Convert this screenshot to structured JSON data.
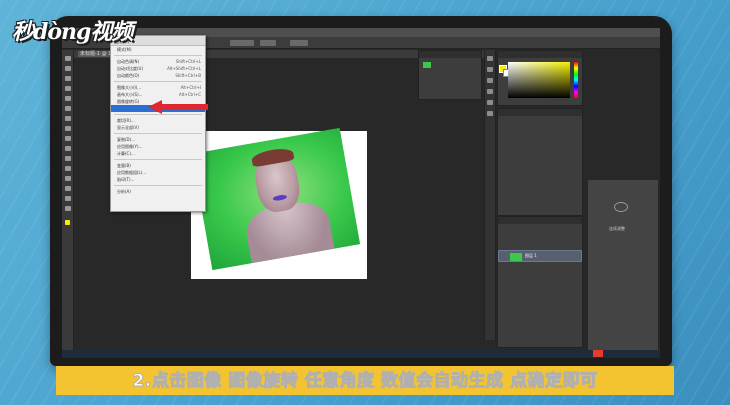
{
  "logo": {
    "text": "秒dòng视频"
  },
  "photoshop": {
    "doc_tab": "未标题-1 @ 100%",
    "menu": {
      "title": "图像(I)",
      "items": [
        {
          "label": "模式(M)",
          "shortcut": ""
        },
        {
          "label": "自动色调(N)",
          "shortcut": "Shift+Ctrl+L"
        },
        {
          "label": "自动对比度(U)",
          "shortcut": "Alt+Shift+Ctrl+L"
        },
        {
          "label": "自动颜色(O)",
          "shortcut": "Shift+Ctrl+B"
        },
        {
          "label": "图像大小(I)...",
          "shortcut": "Alt+Ctrl+I"
        },
        {
          "label": "画布大小(S)...",
          "shortcut": "Alt+Ctrl+C"
        },
        {
          "label": "图像旋转(G)",
          "shortcut": ""
        },
        {
          "label": "",
          "shortcut": ""
        },
        {
          "label": "裁切(R)...",
          "shortcut": ""
        },
        {
          "label": "显示全部(V)",
          "shortcut": ""
        },
        {
          "label": "复制(D)...",
          "shortcut": ""
        },
        {
          "label": "应用图像(Y)...",
          "shortcut": ""
        },
        {
          "label": "计算(C)...",
          "shortcut": ""
        },
        {
          "label": "变量(B)",
          "shortcut": ""
        },
        {
          "label": "应用数据组(L)...",
          "shortcut": ""
        },
        {
          "label": "陷印(T)...",
          "shortcut": ""
        },
        {
          "label": "分析(A)",
          "shortcut": ""
        }
      ],
      "highlighted_index": 7
    },
    "layer_name": "图层 1",
    "side_hint": "连续调整",
    "accent_color": "#f6f000"
  },
  "subtitle": "2.点击图像 图像旋转 任意角度 数值会自动生成 点确定即可",
  "colors": {
    "background": "#4aa3cf",
    "band": "#f4c430",
    "menu_highlight": "#2a6fd1",
    "arrow": "#e0262e"
  }
}
